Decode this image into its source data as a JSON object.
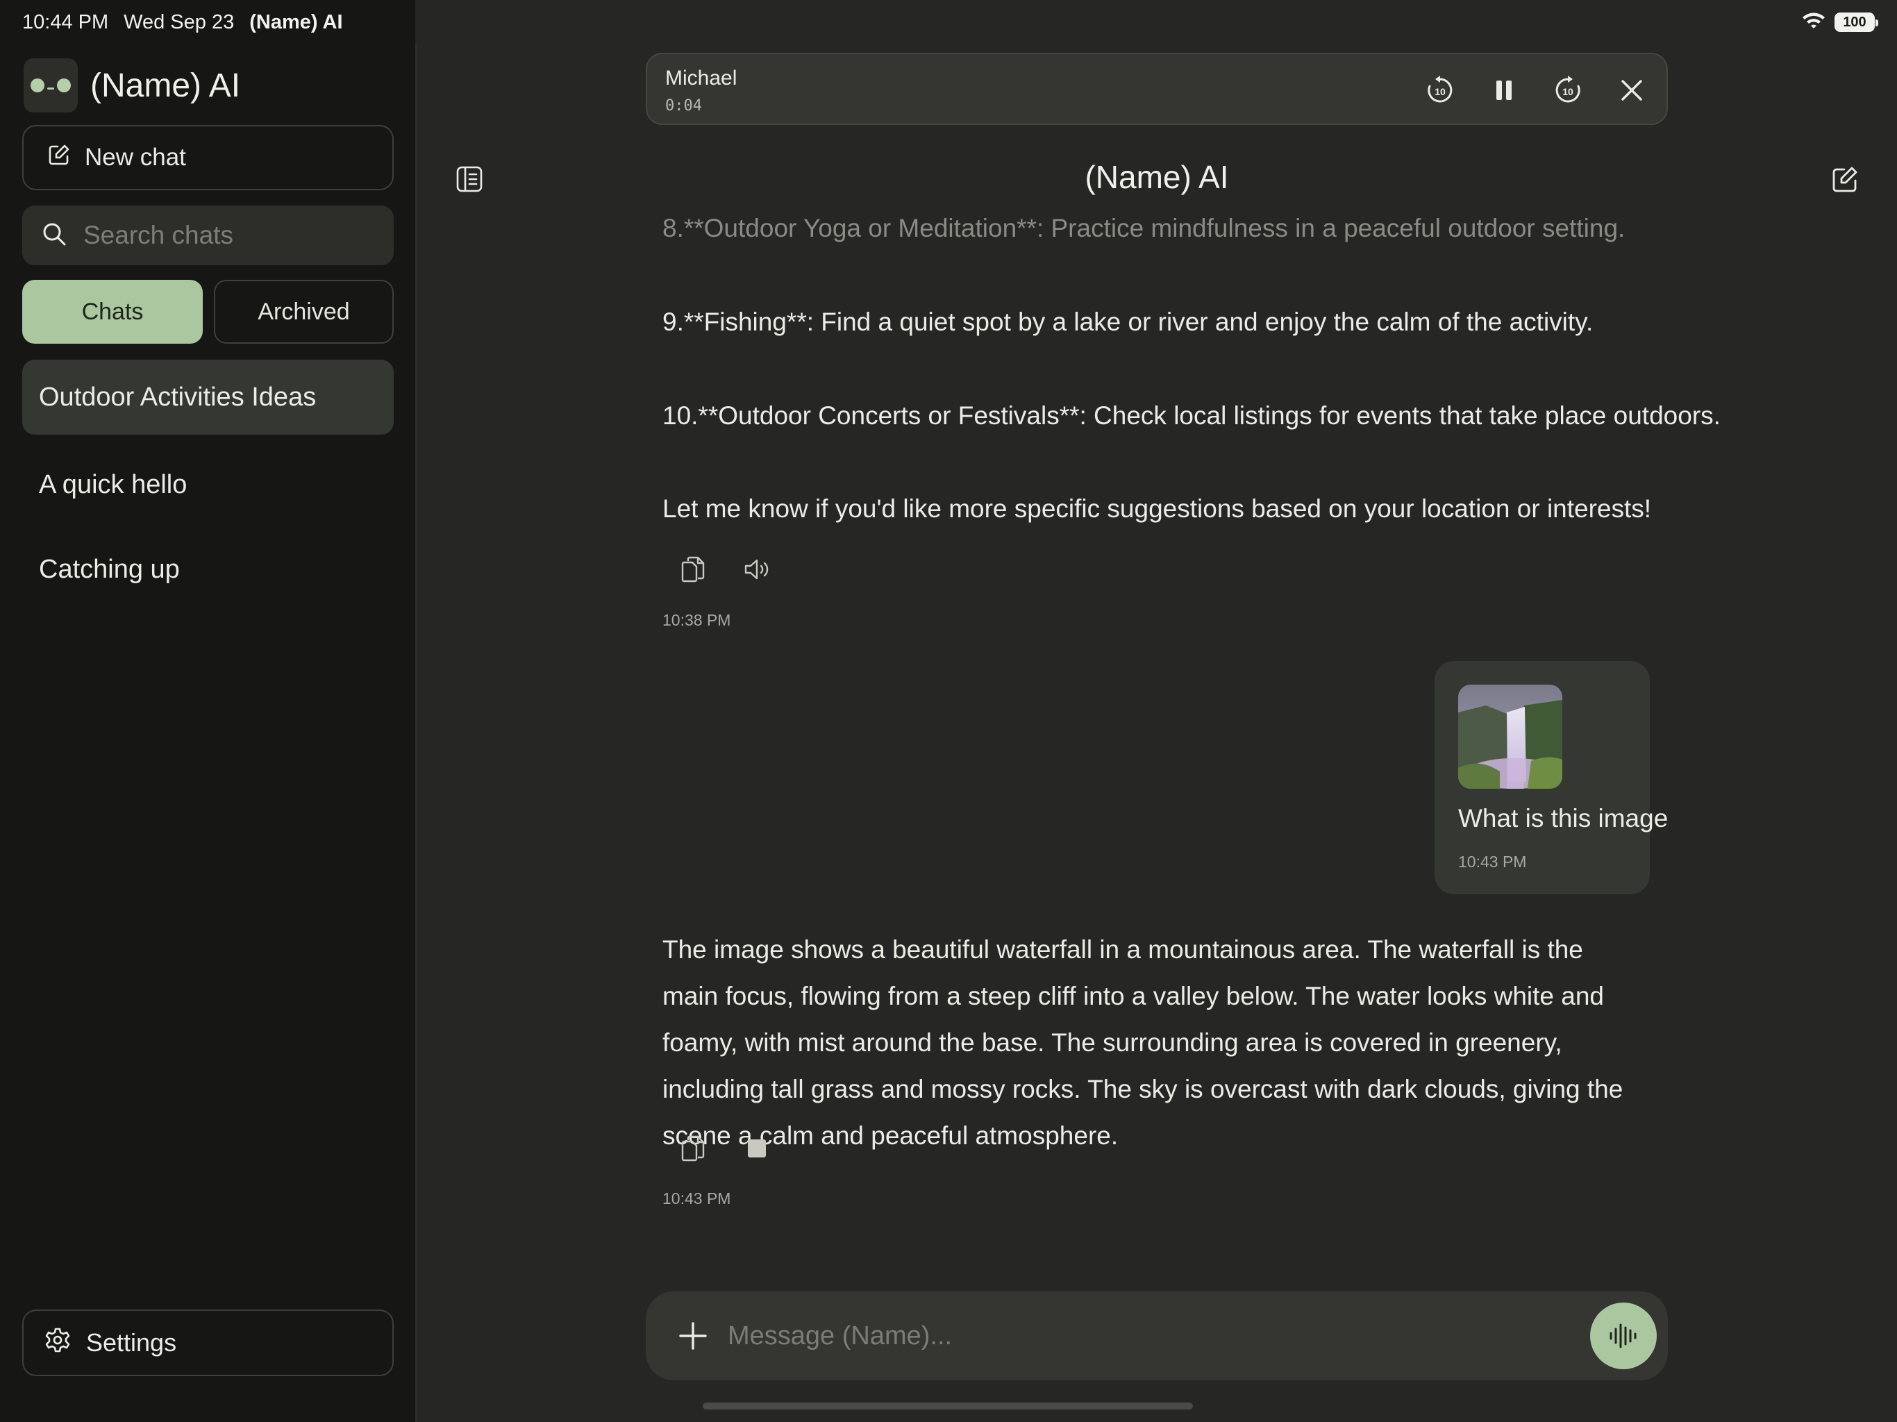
{
  "status_bar": {
    "time": "10:44 PM",
    "date": "Wed Sep 23",
    "app_name": "(Name) AI",
    "battery": "100"
  },
  "sidebar": {
    "brand_name": "(Name) AI",
    "new_chat_label": "New chat",
    "search_placeholder": "Search chats",
    "tabs": {
      "chats": "Chats",
      "archived": "Archived"
    },
    "chats": [
      {
        "title": "Outdoor Activities Ideas",
        "active": true
      },
      {
        "title": "A quick hello",
        "active": false
      },
      {
        "title": "Catching up",
        "active": false
      }
    ],
    "settings_label": "Settings"
  },
  "player": {
    "voice_name": "Michael",
    "elapsed": "0:04",
    "skip_seconds": "10"
  },
  "header": {
    "title": "(Name) AI"
  },
  "conversation": {
    "earlier_lines": [
      "8.**Outdoor Yoga or Meditation**: Practice mindfulness in a peaceful outdoor setting.",
      "9.**Fishing**: Find a quiet spot by a lake or river and enjoy the calm of the activity.",
      "10.**Outdoor Concerts or Festivals**: Check local listings for events that take place outdoors.",
      "Let me know if you'd like more specific suggestions based on your location or interests!"
    ],
    "earlier_time": "10:38 PM",
    "user_message": {
      "text": "What is this image",
      "time": "10:43 PM"
    },
    "reply_text": "The image shows a beautiful waterfall in a mountainous area. The waterfall is the main focus, flowing from a steep cliff into a valley below. The water looks white and foamy, with mist around the base. The surrounding area is covered in greenery, including tall grass and mossy rocks. The sky is overcast with dark clouds, giving the scene a calm and peaceful atmosphere.",
    "reply_time": "10:43 PM"
  },
  "composer": {
    "placeholder": "Message (Name)..."
  },
  "icons": {
    "brand": "brand-logo-icon",
    "new_chat": "compose-icon",
    "search": "search-icon",
    "settings": "gear-icon",
    "rewind": "rewind-10-icon",
    "pause": "pause-icon",
    "forward": "forward-10-icon",
    "close": "close-icon",
    "sidebar_toggle": "sidebar-icon",
    "copy": "copy-icon",
    "speaker": "speaker-icon",
    "stop": "stop-icon",
    "plus": "plus-icon",
    "voice": "voice-wave-icon"
  },
  "colors": {
    "accent": "#abc79f",
    "background": "#262724",
    "sidebar_background": "#161614",
    "surface": "#353632"
  }
}
